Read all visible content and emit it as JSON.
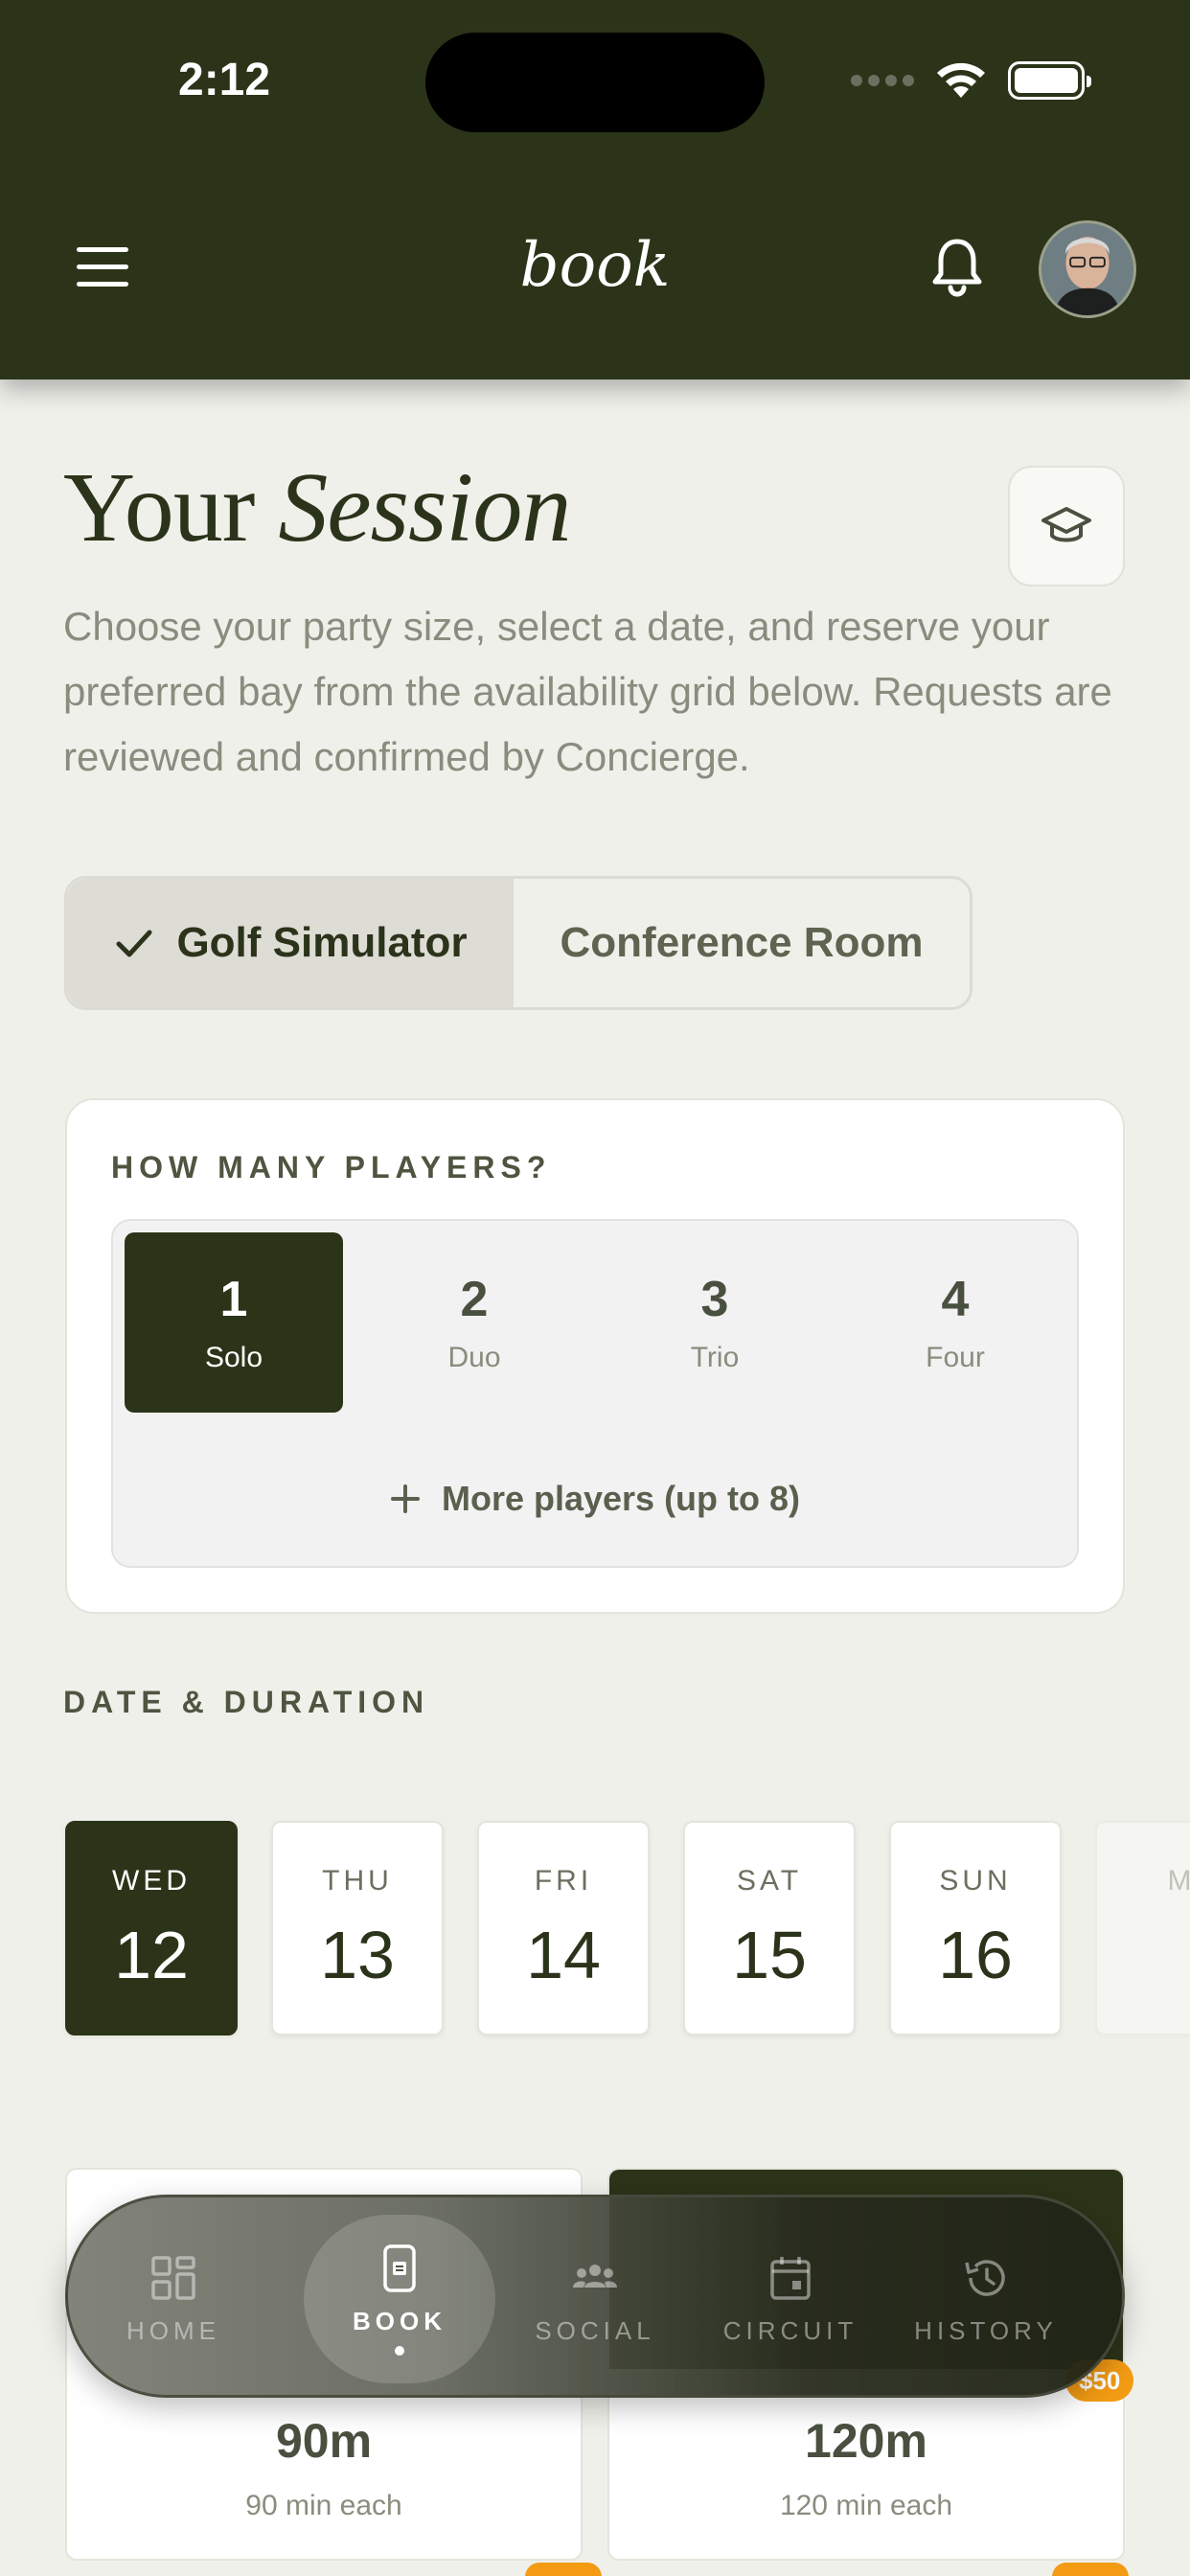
{
  "status_bar": {
    "time": "2:12"
  },
  "header": {
    "title": "book"
  },
  "page": {
    "title_regular": "Your",
    "title_italic": "Session",
    "description": "Choose your party size, select a date, and reserve your preferred bay from the availability grid below. Requests are reviewed and confirmed by Concierge."
  },
  "venue_toggle": {
    "options": [
      {
        "label": "Golf Simulator",
        "selected": true
      },
      {
        "label": "Conference Room",
        "selected": false
      }
    ]
  },
  "players": {
    "heading": "HOW MANY PLAYERS?",
    "options": [
      {
        "count": "1",
        "label": "Solo",
        "selected": true
      },
      {
        "count": "2",
        "label": "Duo",
        "selected": false
      },
      {
        "count": "3",
        "label": "Trio",
        "selected": false
      },
      {
        "count": "4",
        "label": "Four",
        "selected": false
      }
    ],
    "more_label": "More players (up to 8)"
  },
  "date_duration": {
    "heading": "DATE & DURATION",
    "dates": [
      {
        "dow": "WED",
        "day": "12",
        "selected": true
      },
      {
        "dow": "THU",
        "day": "13",
        "selected": false
      },
      {
        "dow": "FRI",
        "day": "14",
        "selected": false
      },
      {
        "dow": "SAT",
        "day": "15",
        "selected": false
      },
      {
        "dow": "SUN",
        "day": "16",
        "selected": false
      },
      {
        "dow": "M",
        "day": "",
        "selected": false
      }
    ],
    "durations": [
      {
        "value": "90m",
        "sub": "90 min each"
      },
      {
        "value": "120m",
        "sub": "120 min each",
        "badge": "$50"
      }
    ]
  },
  "bottom_nav": {
    "items": [
      {
        "label": "HOME",
        "icon": "grid-icon",
        "active": false
      },
      {
        "label": "BOOK",
        "icon": "booking-icon",
        "active": true
      },
      {
        "label": "SOCIAL",
        "icon": "people-icon",
        "active": false
      },
      {
        "label": "CIRCUIT",
        "icon": "calendar-icon",
        "active": false
      },
      {
        "label": "HISTORY",
        "icon": "history-icon",
        "active": false
      }
    ]
  },
  "colors": {
    "header_bg": "#2b3418",
    "page_bg": "#f0f0eb",
    "accent_dark": "#2b3418",
    "badge_orange": "#f29b13"
  }
}
